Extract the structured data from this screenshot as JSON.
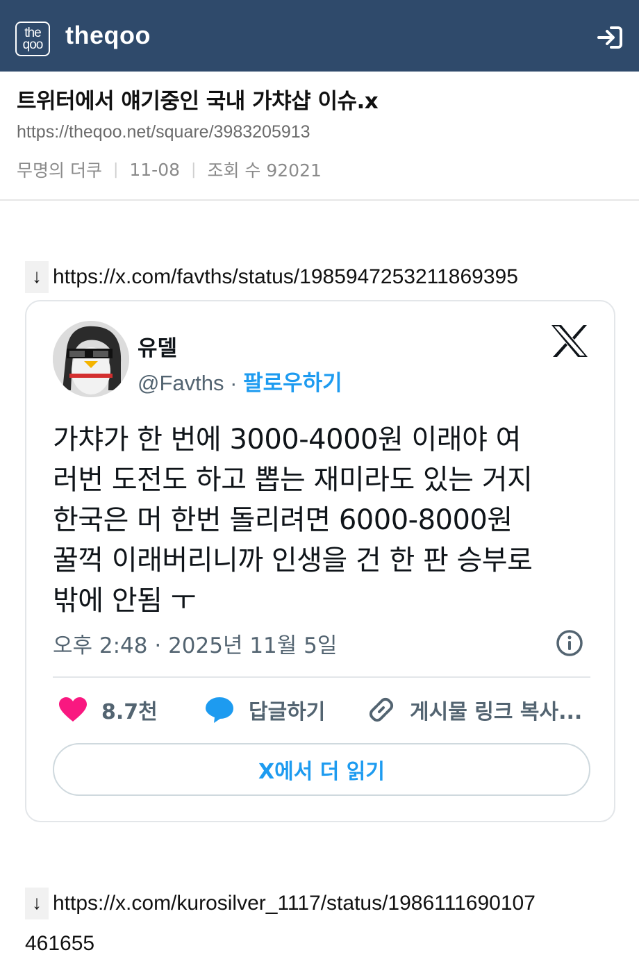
{
  "header": {
    "logo_line1": "the",
    "logo_line2": "qoo",
    "brand": "theqoo"
  },
  "article": {
    "title": "트위터에서 얘기중인 국내 가챠샵 이슈.x",
    "url": "https://theqoo.net/square/3983205913",
    "author": "무명의 더쿠",
    "date": "11-08",
    "views_label": "조회 수 92021"
  },
  "links": [
    {
      "arrow": "↓",
      "text": "https://x.com/favths/status/1985947253211869395"
    },
    {
      "arrow": "↓",
      "text_line1": "https://x.com/kurosilver_1117/status/1986111690107",
      "text_line2": "461655"
    }
  ],
  "tweet": {
    "display_name": "유델",
    "handle": "@Favths",
    "dot": "·",
    "follow_label": "팔로우하기",
    "lines": [
      "가챠가 한 번에 3000-4000원 이래야 여",
      "러번 도전도 하고 뽑는 재미라도 있는 거지",
      "한국은 머 한번 돌리려면 6000-8000원",
      "꿀꺽 이래버리니까 인생을 건 한 판 승부로",
      "밖에 안됨 ㅜ"
    ],
    "timestamp": "오후 2:48 · 2025년 11월 5일",
    "likes": "8.7천",
    "reply_label": "답글하기",
    "copy_label": "게시물 링크 복사...",
    "read_more": "X에서 더 읽기"
  },
  "colors": {
    "topbar": "#2f4a6b",
    "link_blue": "#1d9bf0",
    "heart": "#f91880"
  }
}
